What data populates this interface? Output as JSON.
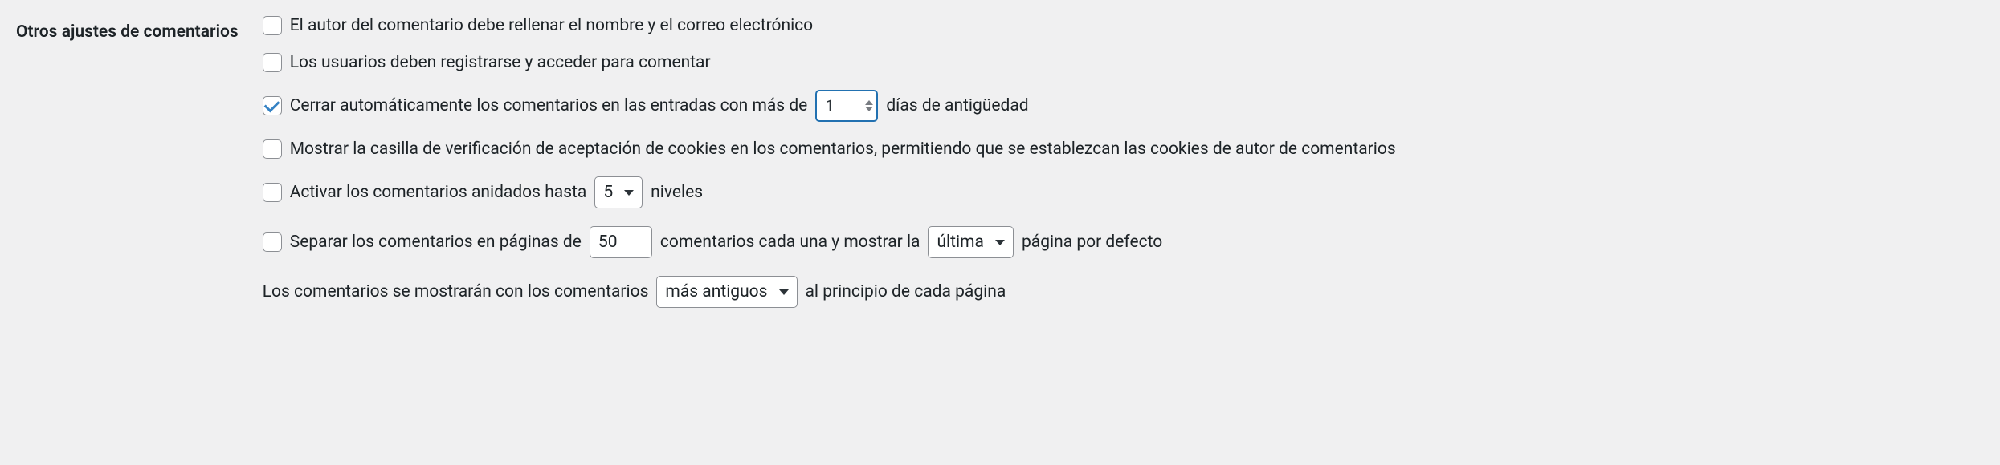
{
  "section_title": "Otros ajustes de comentarios",
  "settings": {
    "require_name_email": {
      "label": "El autor del comentario debe rellenar el nombre y el correo electrónico",
      "checked": false
    },
    "require_registration": {
      "label": "Los usuarios deben registrarse y acceder para comentar",
      "checked": false
    },
    "close_comments": {
      "label_before": "Cerrar automáticamente los comentarios en las entradas con más de",
      "value": "1",
      "label_after": "días de antigüedad",
      "checked": true
    },
    "cookies_optin": {
      "label": "Mostrar la casilla de verificación de aceptación de cookies en los comentarios, permitiendo que se establezcan las cookies de autor de comentarios",
      "checked": false
    },
    "thread_comments": {
      "label_before": "Activar los comentarios anidados hasta",
      "value": "5",
      "label_after": "niveles",
      "checked": false
    },
    "page_comments": {
      "label_before": "Separar los comentarios en páginas de",
      "per_page": "50",
      "label_mid": "comentarios cada una y mostrar la",
      "default_page": "última",
      "label_after": "página por defecto",
      "checked": false
    },
    "comment_order": {
      "label_before": "Los comentarios se mostrarán con los comentarios",
      "order": "más antiguos",
      "label_after": "al principio de cada página"
    }
  }
}
